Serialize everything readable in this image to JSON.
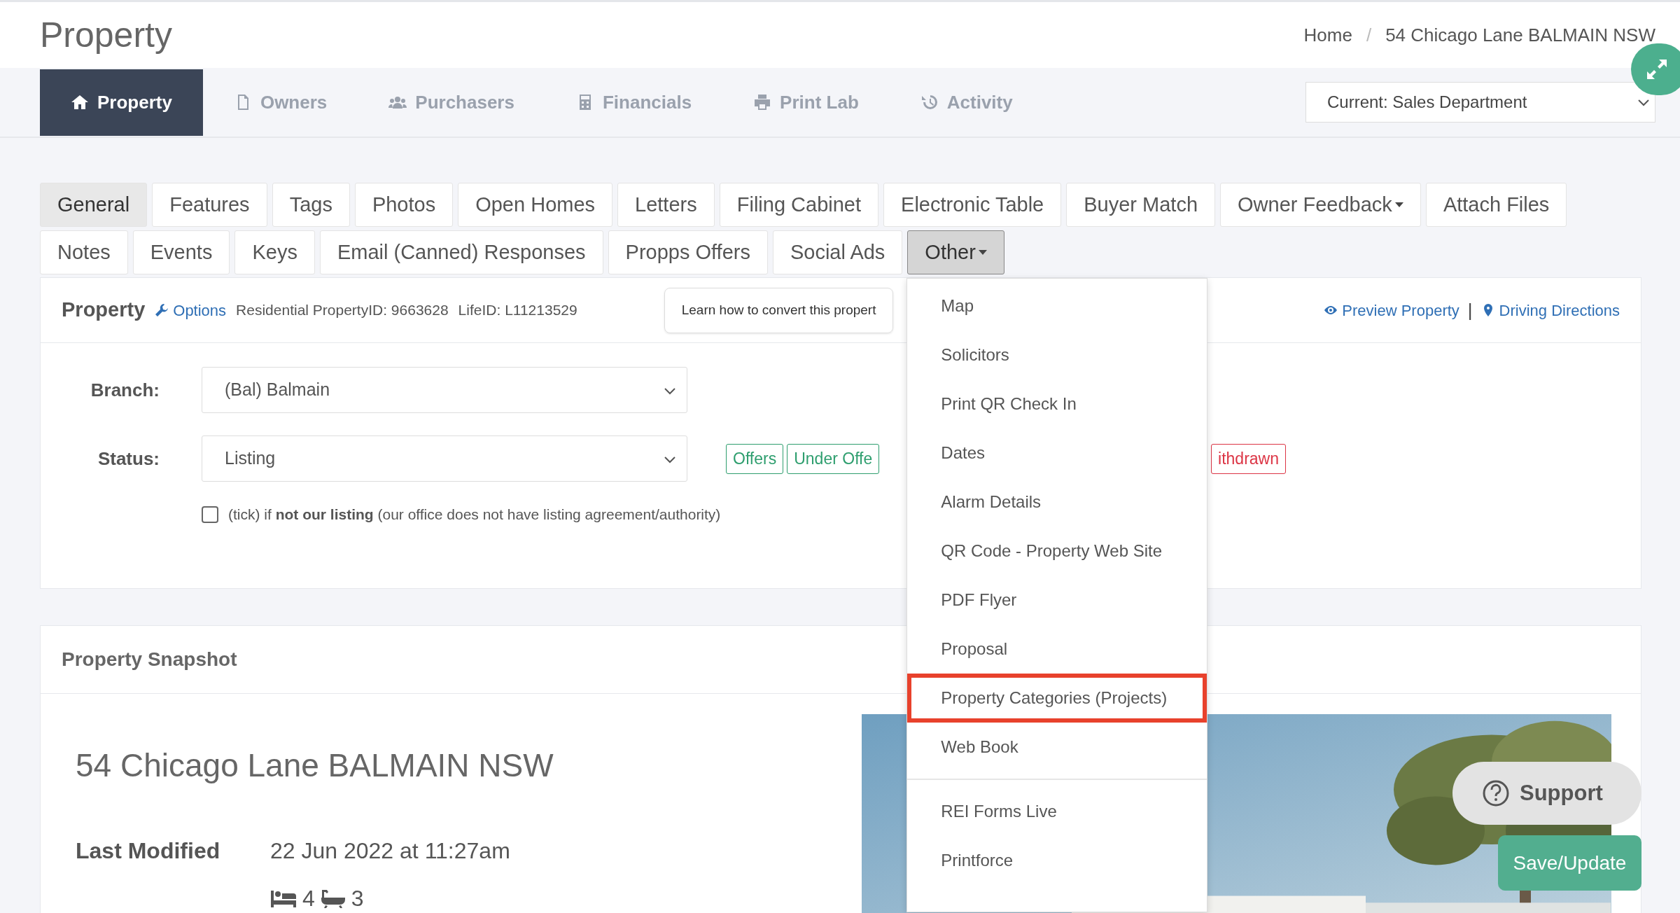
{
  "page_title": "Property",
  "breadcrumb": [
    {
      "label": "Home"
    },
    {
      "label": "54 Chicago Lane BALMAIN NSW"
    }
  ],
  "breadcrumb_separator": "/",
  "main_tabs": [
    {
      "label": "Property",
      "selected": true
    },
    {
      "label": "Owners",
      "selected": false
    },
    {
      "label": "Purchasers",
      "selected": false
    },
    {
      "label": "Financials",
      "selected": false
    },
    {
      "label": "Print Lab",
      "selected": false
    },
    {
      "label": "Activity",
      "selected": false
    }
  ],
  "department": {
    "value": "Current: Sales Department"
  },
  "sub_tab_rows": [
    [
      {
        "label": "General",
        "selected": true,
        "dropdown": false,
        "open": false
      },
      {
        "label": "Features",
        "selected": false,
        "dropdown": false,
        "open": false
      },
      {
        "label": "Tags",
        "selected": false,
        "dropdown": false,
        "open": false
      },
      {
        "label": "Photos",
        "selected": false,
        "dropdown": false,
        "open": false
      },
      {
        "label": "Open Homes",
        "selected": false,
        "dropdown": false,
        "open": false
      },
      {
        "label": "Letters",
        "selected": false,
        "dropdown": false,
        "open": false
      },
      {
        "label": "Filing Cabinet",
        "selected": false,
        "dropdown": false,
        "open": false
      },
      {
        "label": "Electronic Table",
        "selected": false,
        "dropdown": false,
        "open": false
      },
      {
        "label": "Buyer Match",
        "selected": false,
        "dropdown": false,
        "open": false
      },
      {
        "label": "Owner Feedback",
        "selected": false,
        "dropdown": true,
        "open": false
      },
      {
        "label": "Attach Files",
        "selected": false,
        "dropdown": false,
        "open": false
      }
    ],
    [
      {
        "label": "Notes",
        "selected": false,
        "dropdown": false,
        "open": false
      },
      {
        "label": "Events",
        "selected": false,
        "dropdown": false,
        "open": false
      },
      {
        "label": "Keys",
        "selected": false,
        "dropdown": false,
        "open": false
      },
      {
        "label": "Email (Canned) Responses",
        "selected": false,
        "dropdown": false,
        "open": false
      },
      {
        "label": "Propps Offers",
        "selected": false,
        "dropdown": false,
        "open": false
      },
      {
        "label": "Social Ads",
        "selected": false,
        "dropdown": false,
        "open": false
      },
      {
        "label": "Other",
        "selected": false,
        "dropdown": true,
        "open": true
      }
    ]
  ],
  "dropdown_menu": {
    "groups": [
      [
        {
          "label": "Map",
          "highlighted": false
        },
        {
          "label": "Solicitors",
          "highlighted": false
        },
        {
          "label": "Print QR Check In",
          "highlighted": false
        },
        {
          "label": "Dates",
          "highlighted": false
        },
        {
          "label": "Alarm Details",
          "highlighted": false
        },
        {
          "label": "QR Code - Property Web Site",
          "highlighted": false
        },
        {
          "label": "PDF Flyer",
          "highlighted": false
        },
        {
          "label": "Proposal",
          "highlighted": false
        },
        {
          "label": "Property Categories (Projects)",
          "highlighted": true
        },
        {
          "label": "Web Book",
          "highlighted": false
        }
      ],
      [
        {
          "label": "REI Forms Live",
          "highlighted": false
        },
        {
          "label": "Printforce",
          "highlighted": false
        }
      ]
    ]
  },
  "property_panel": {
    "title": "Property",
    "options_link": "Options",
    "property_id": "Residential PropertyID: 9663628",
    "life_id": "LifeID: L11213529",
    "tooltip": "Learn how to convert this propert",
    "links": [
      {
        "label": "Preview Property"
      },
      {
        "label": "Driving Directions"
      }
    ],
    "link_separator": "|",
    "branch": {
      "label": "Branch:",
      "value": "(Bal) Balmain"
    },
    "status": {
      "label": "Status:",
      "value": "Listing"
    },
    "status_badges": [
      {
        "label": "Offers",
        "color": "#2e9e6e"
      },
      {
        "label": "Under Offe",
        "color": "#2e9e6e"
      },
      {
        "label": "ithdrawn",
        "color": "#dc3545"
      }
    ],
    "not_our_listing": {
      "checked": false,
      "text": "(tick) if **not our listing** (our office does not have listing agreement/authority)"
    }
  },
  "snapshot": {
    "title": "Property Snapshot",
    "address": "54 Chicago Lane BALMAIN NSW",
    "last_modified_label": "Last Modified",
    "last_modified_value": "22 Jun 2022 at 11:27am",
    "bedrooms": "4",
    "bathrooms": "3"
  },
  "support_button": "Support",
  "save_button": "Save/Update"
}
